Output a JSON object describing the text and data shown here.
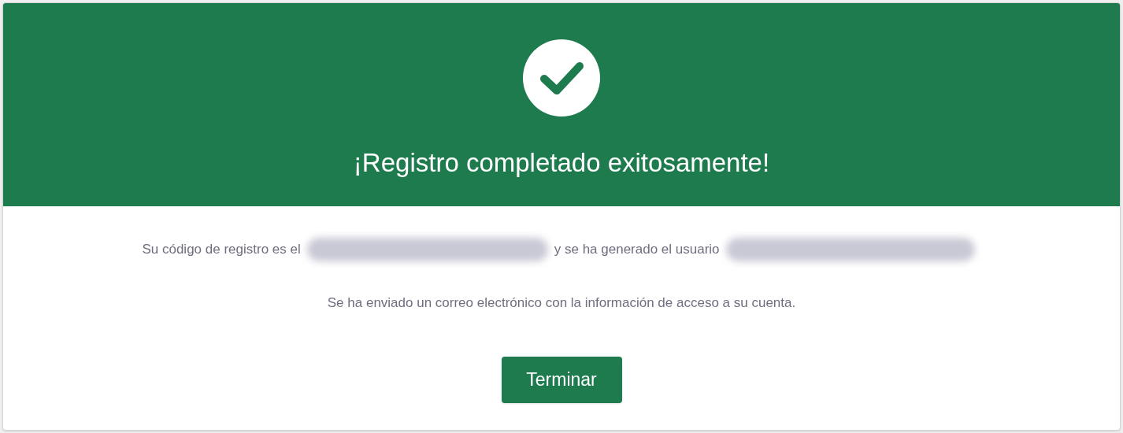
{
  "header": {
    "title": "¡Registro completado exitosamente!"
  },
  "message": {
    "code_prefix": "Su código de registro es el",
    "user_prefix": "y se ha generado el usuario"
  },
  "note": "Se ha enviado un correo electrónico con la información de acceso a su cuenta.",
  "button": "Terminar"
}
